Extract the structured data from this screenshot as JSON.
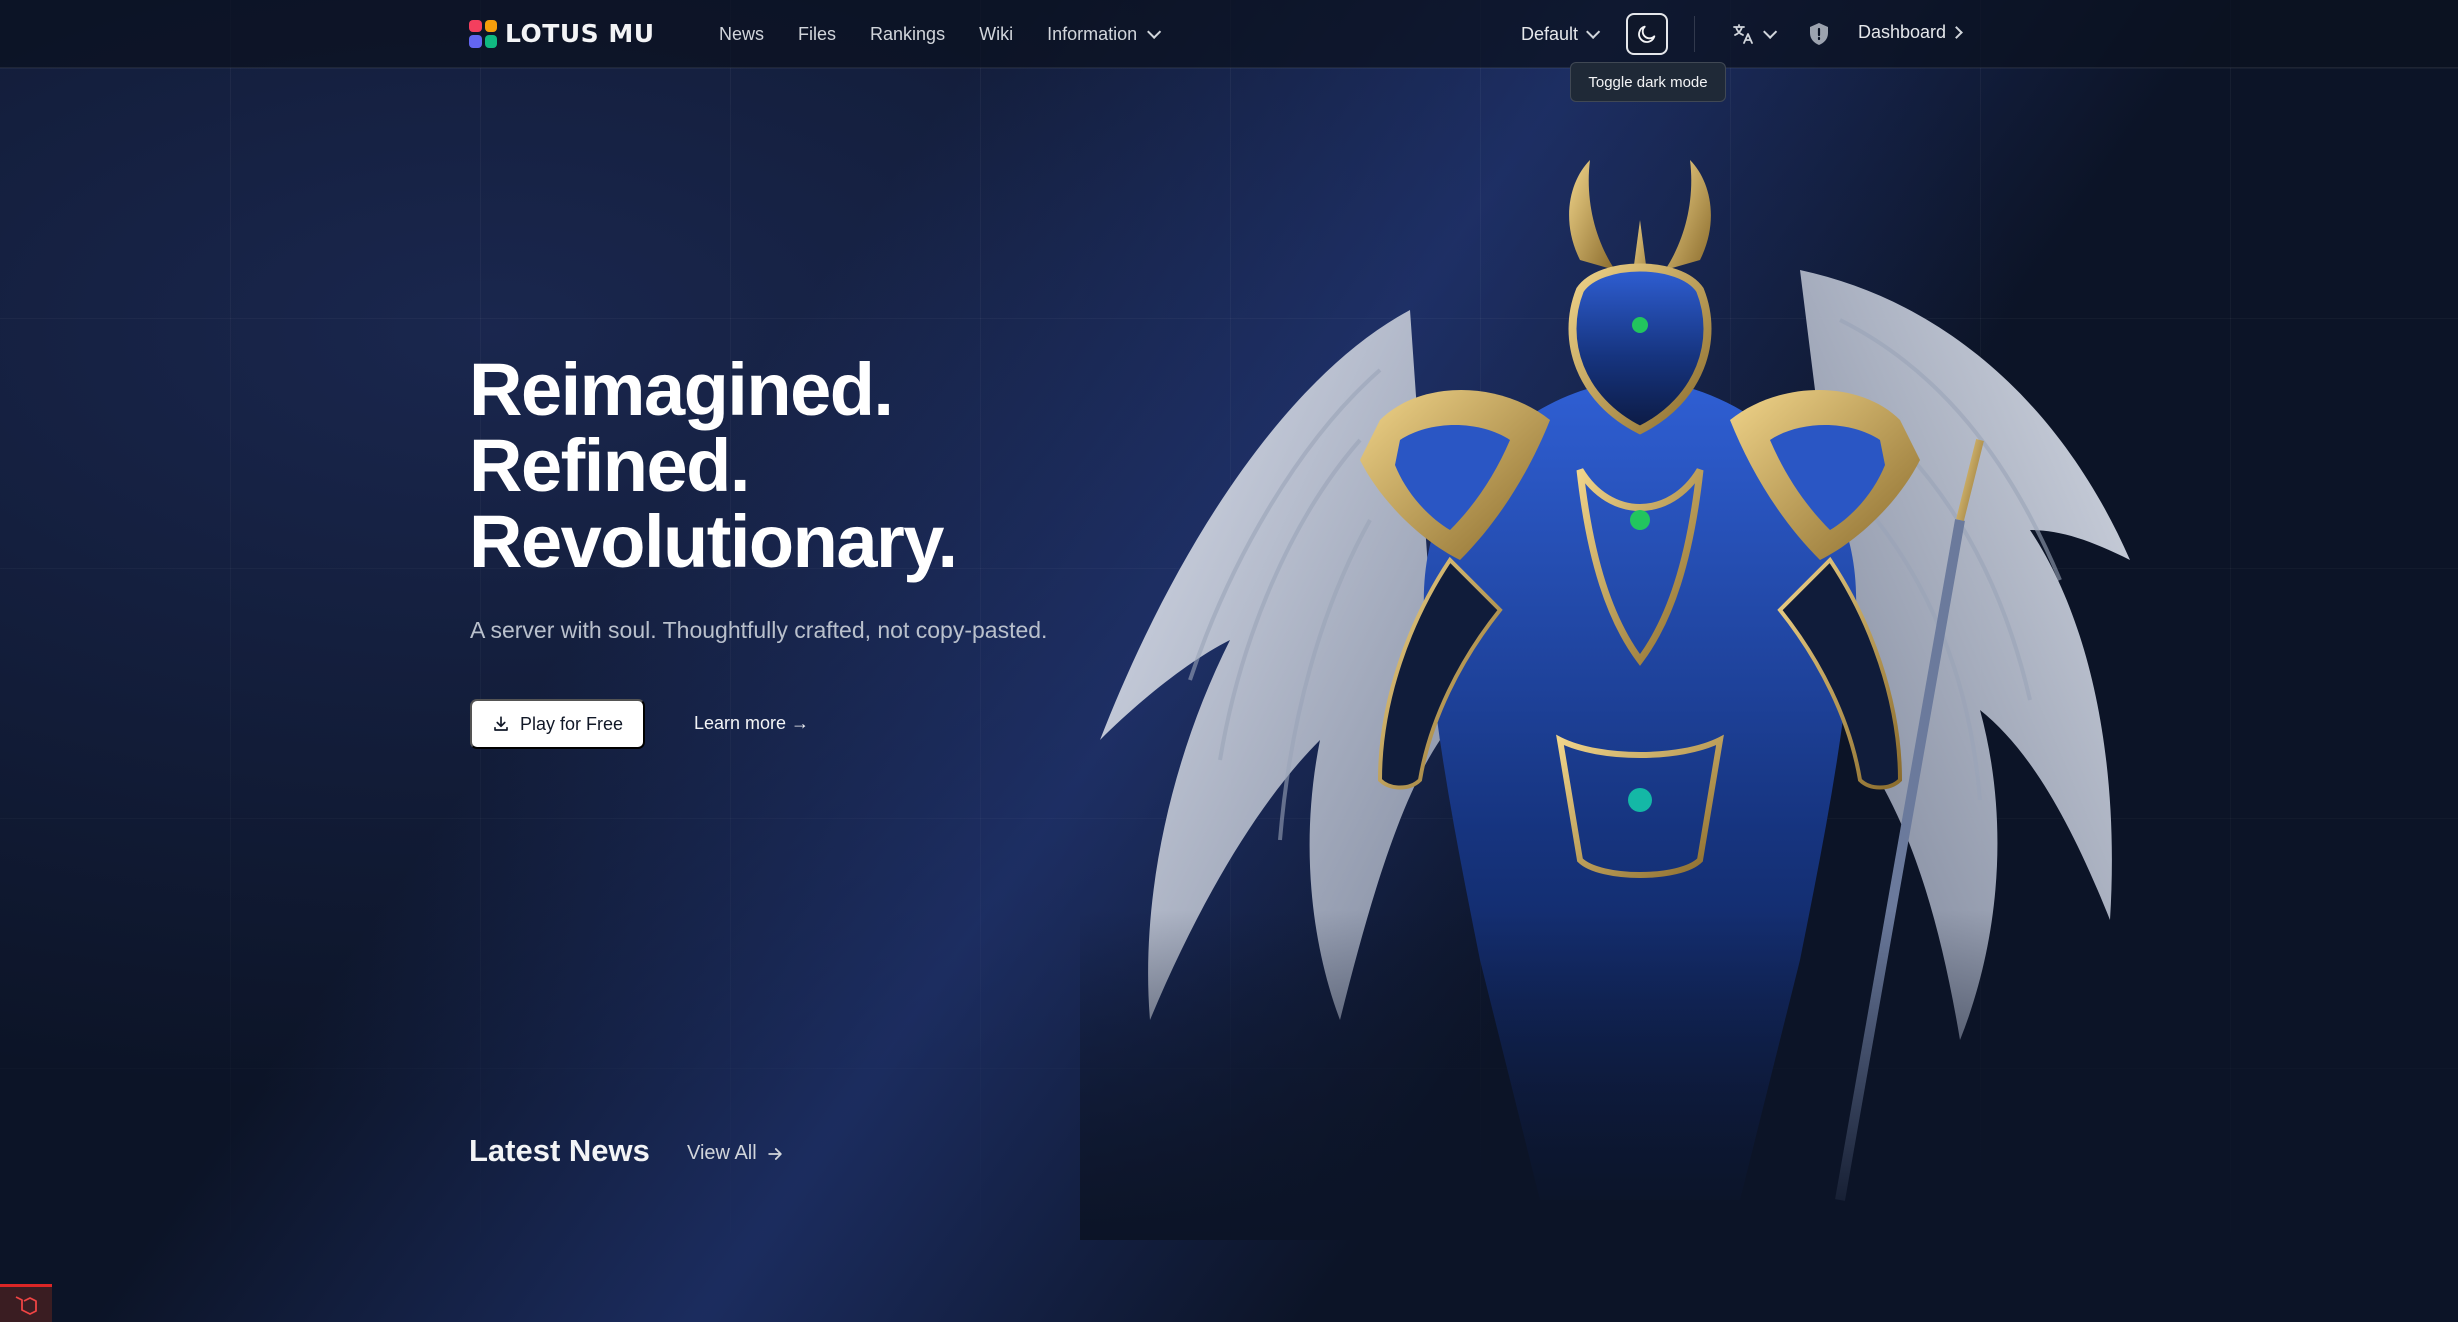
{
  "brand": {
    "name": "LOTUS MU",
    "colors": [
      "#f43f5e",
      "#f59e0b",
      "#6366f1",
      "#10b981"
    ]
  },
  "nav": {
    "links": [
      "News",
      "Files",
      "Rankings",
      "Wiki"
    ],
    "information_label": "Information",
    "theme_select": "Default",
    "dark_mode_tooltip": "Toggle dark mode",
    "dashboard_label": "Dashboard",
    "icons": {
      "theme": "moon-icon",
      "language": "translate-icon",
      "admin": "shield-icon"
    }
  },
  "hero": {
    "title_lines": [
      "Reimagined.",
      "Refined.",
      "Revolutionary."
    ],
    "subtitle": "A server with soul. Thoughtfully crafted, not copy-pasted.",
    "play_button": "Play for Free",
    "learn_more": "Learn more →",
    "art": "armored-winged-warrior"
  },
  "news": {
    "title": "Latest News",
    "view_all": "View All"
  },
  "colors": {
    "background": "#0c1427",
    "accent_blue": "#2f5fd4",
    "gold": "#c9a55a"
  }
}
